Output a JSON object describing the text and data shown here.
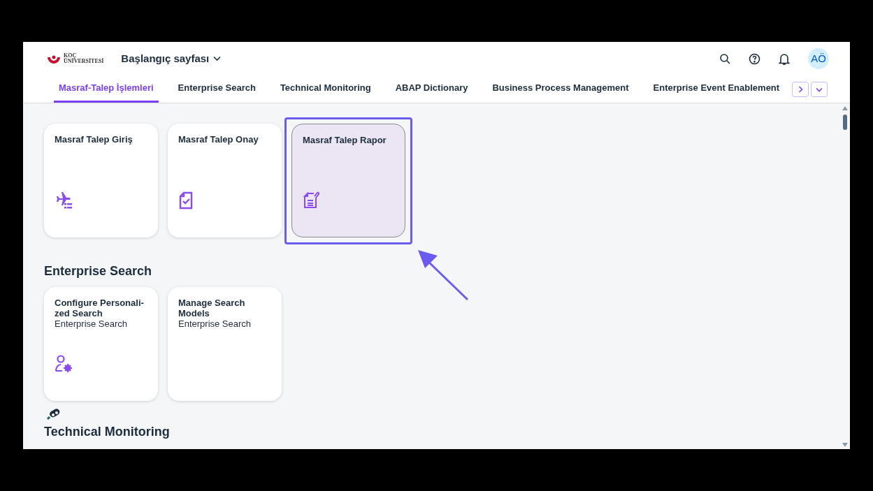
{
  "header": {
    "logo_lines": [
      "KOÇ",
      "ÜNİVERSİTESİ"
    ],
    "page_title": "Başlangıç sayfası",
    "avatar": "AÖ"
  },
  "tabs": [
    {
      "label": "Masraf-Talep İşlemleri",
      "selected": true
    },
    {
      "label": "Enterprise Search",
      "selected": false
    },
    {
      "label": "Technical Monitoring",
      "selected": false
    },
    {
      "label": "ABAP Dictionary",
      "selected": false
    },
    {
      "label": "Business Process Management",
      "selected": false
    },
    {
      "label": "Enterprise Event Enablement",
      "selected": false
    }
  ],
  "sections": [
    {
      "tiles": [
        {
          "title": "Masraf Talep Giriş",
          "kind": "plane",
          "highlighted": false
        },
        {
          "title": "Masraf Talep Onay",
          "kind": "doc-check",
          "highlighted": false
        },
        {
          "title": "Masraf Talep Rapor",
          "kind": "doc-note",
          "highlighted": true
        }
      ]
    },
    {
      "title": "Enterprise Search",
      "tiles": [
        {
          "title": "Configure Personali-\nzed Search",
          "subtitle": "Enterprise Search",
          "kind": "user-gear",
          "highlighted": false
        },
        {
          "title": "Manage Search\nModels",
          "subtitle": "Enterprise Search",
          "kind": "none",
          "highlighted": false
        }
      ]
    },
    {
      "title": "Technical Monitoring",
      "icon": true
    }
  ]
}
